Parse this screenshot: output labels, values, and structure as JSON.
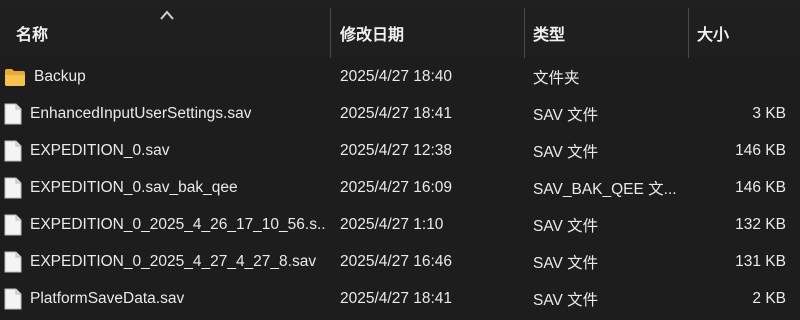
{
  "columns": {
    "name": "名称",
    "date": "修改日期",
    "type": "类型",
    "size": "大小"
  },
  "files": [
    {
      "name": "Backup",
      "date": "2025/4/27 18:40",
      "type": "文件夹",
      "size": "",
      "icon": "folder-icon"
    },
    {
      "name": "EnhancedInputUserSettings.sav",
      "date": "2025/4/27 18:41",
      "type": "SAV 文件",
      "size": "3 KB",
      "icon": "file-icon"
    },
    {
      "name": "EXPEDITION_0.sav",
      "date": "2025/4/27 12:38",
      "type": "SAV 文件",
      "size": "146 KB",
      "icon": "file-icon"
    },
    {
      "name": "EXPEDITION_0.sav_bak_qee",
      "date": "2025/4/27 16:09",
      "type": "SAV_BAK_QEE 文...",
      "size": "146 KB",
      "icon": "file-icon"
    },
    {
      "name": "EXPEDITION_0_2025_4_26_17_10_56.s...",
      "date": "2025/4/27 1:10",
      "type": "SAV 文件",
      "size": "132 KB",
      "icon": "file-icon"
    },
    {
      "name": "EXPEDITION_0_2025_4_27_4_27_8.sav",
      "date": "2025/4/27 16:46",
      "type": "SAV 文件",
      "size": "131 KB",
      "icon": "file-icon"
    },
    {
      "name": "PlatformSaveData.sav",
      "date": "2025/4/27 18:41",
      "type": "SAV 文件",
      "size": "2 KB",
      "icon": "file-icon"
    }
  ]
}
